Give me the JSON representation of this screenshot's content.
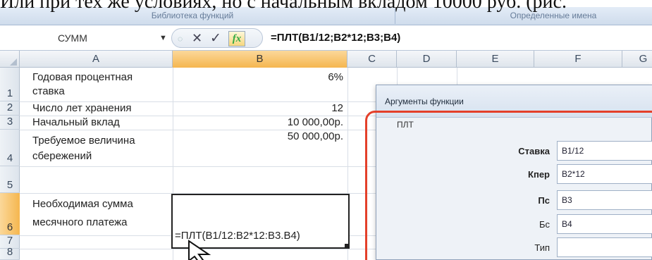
{
  "document": {
    "text": "Или при тех же условиях, но с начальным вкладом 10000 руб. (рис."
  },
  "ribbon": {
    "group_library": "Библиотека функций",
    "group_names": "Определенные имена"
  },
  "formula_bar": {
    "name_box": "СУММ",
    "cancel_icon": "cancel-x-icon",
    "enter_icon": "enter-check-icon",
    "insert_function_label": "fx",
    "formula": "=ПЛТ(B1/12;B2*12;B3;B4)"
  },
  "columns": [
    "A",
    "B",
    "C",
    "D",
    "E",
    "F",
    "G"
  ],
  "selected_column": "B",
  "rows": [
    {
      "num": "1",
      "a": [
        "Годовая процентная",
        "ставка"
      ],
      "b": "6%"
    },
    {
      "num": "2",
      "a": [
        "Число лет хранения"
      ],
      "b": "12"
    },
    {
      "num": "3",
      "a": [
        "Начальный вклад"
      ],
      "b": "10 000,00р."
    },
    {
      "num": "4",
      "a": [
        "Требуемое величина",
        "сбережений"
      ],
      "b": "50 000,00р."
    },
    {
      "num": "5",
      "a": [],
      "b": ""
    },
    {
      "num": "6",
      "a": [
        "Необходимая сумма",
        "месячного платежа"
      ],
      "b": "=ПЛТ(B1/12:B2*12:B3.B4)"
    },
    {
      "num": "7",
      "a": [],
      "b": ""
    },
    {
      "num": "8",
      "a": [],
      "b": ""
    }
  ],
  "selected_row": "6",
  "dialog": {
    "title": "Аргументы функции",
    "function_name": "ПЛТ",
    "args": [
      {
        "label": "Ставка",
        "value": "B1/12",
        "required": true
      },
      {
        "label": "Кпер",
        "value": "B2*12",
        "required": true
      },
      {
        "label": "Пс",
        "value": "B3",
        "required": true
      },
      {
        "label": "Бс",
        "value": "B4",
        "required": false
      },
      {
        "label": "Тип",
        "value": "",
        "required": false
      }
    ]
  },
  "colors": {
    "highlight": "#e4402a",
    "selected_header": "#f5b64f",
    "grid_line": "#d8dee6"
  }
}
